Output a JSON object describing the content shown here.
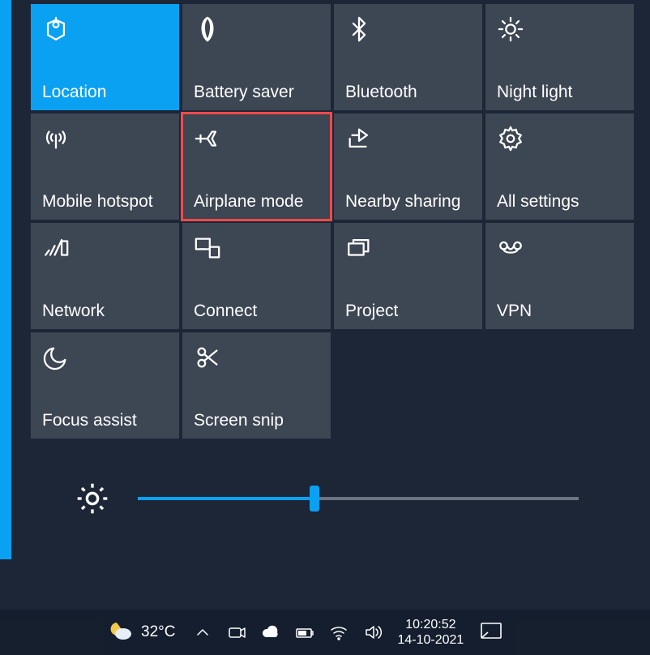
{
  "tiles": [
    {
      "id": "location",
      "label": "Location",
      "icon": "location-icon",
      "active": true
    },
    {
      "id": "battery-saver",
      "label": "Battery saver",
      "icon": "leaf-icon"
    },
    {
      "id": "bluetooth",
      "label": "Bluetooth",
      "icon": "bluetooth-icon"
    },
    {
      "id": "night-light",
      "label": "Night light",
      "icon": "sun-icon"
    },
    {
      "id": "mobile-hotspot",
      "label": "Mobile hotspot",
      "icon": "hotspot-icon"
    },
    {
      "id": "airplane-mode",
      "label": "Airplane mode",
      "icon": "airplane-icon",
      "highlighted": true
    },
    {
      "id": "nearby-sharing",
      "label": "Nearby sharing",
      "icon": "share-icon"
    },
    {
      "id": "all-settings",
      "label": "All settings",
      "icon": "gear-icon"
    },
    {
      "id": "network",
      "label": "Network",
      "icon": "wifi-bars-icon"
    },
    {
      "id": "connect",
      "label": "Connect",
      "icon": "connect-icon"
    },
    {
      "id": "project",
      "label": "Project",
      "icon": "project-icon"
    },
    {
      "id": "vpn",
      "label": "VPN",
      "icon": "vpn-icon"
    },
    {
      "id": "focus-assist",
      "label": "Focus assist",
      "icon": "moon-icon"
    },
    {
      "id": "screen-snip",
      "label": "Screen snip",
      "icon": "snip-icon"
    }
  ],
  "brightness": {
    "percent": 40
  },
  "taskbar": {
    "weather": {
      "temp": "32°C",
      "icon": "weather-moon-cloud-icon"
    },
    "tray_icons": [
      "chevron-up-icon",
      "camera-icon",
      "cloud-icon",
      "battery-icon",
      "wifi-icon",
      "volume-icon"
    ],
    "time": "10:20:52",
    "date": "14-10-2021"
  }
}
